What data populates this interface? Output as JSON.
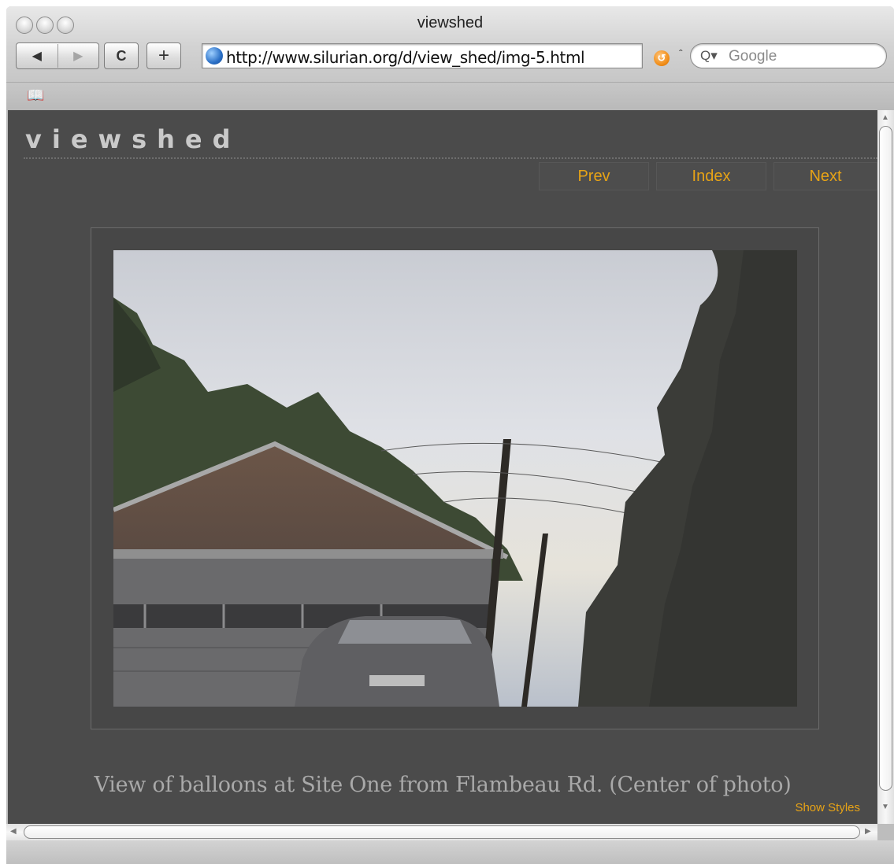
{
  "window": {
    "title": "viewshed"
  },
  "toolbar": {
    "back_icon": "back-arrow-icon",
    "forward_icon": "forward-arrow-icon",
    "reload_icon": "reload-icon",
    "reload_glyph": "C",
    "add_bookmark_glyph": "+",
    "url": "http://www.silurian.org/d/view_shed/img-5.html",
    "search_placeholder": "Google"
  },
  "page": {
    "site_logo": "viewshed",
    "nav": {
      "prev": "Prev",
      "index": "Index",
      "next": "Next"
    },
    "caption": "View of balloons at Site One from Flambeau Rd. (Center of photo)",
    "show_styles": "Show Styles"
  },
  "colors": {
    "page_background": "#4b4b4b",
    "nav_link": "#e7a316",
    "caption": "#a9a9a9"
  }
}
